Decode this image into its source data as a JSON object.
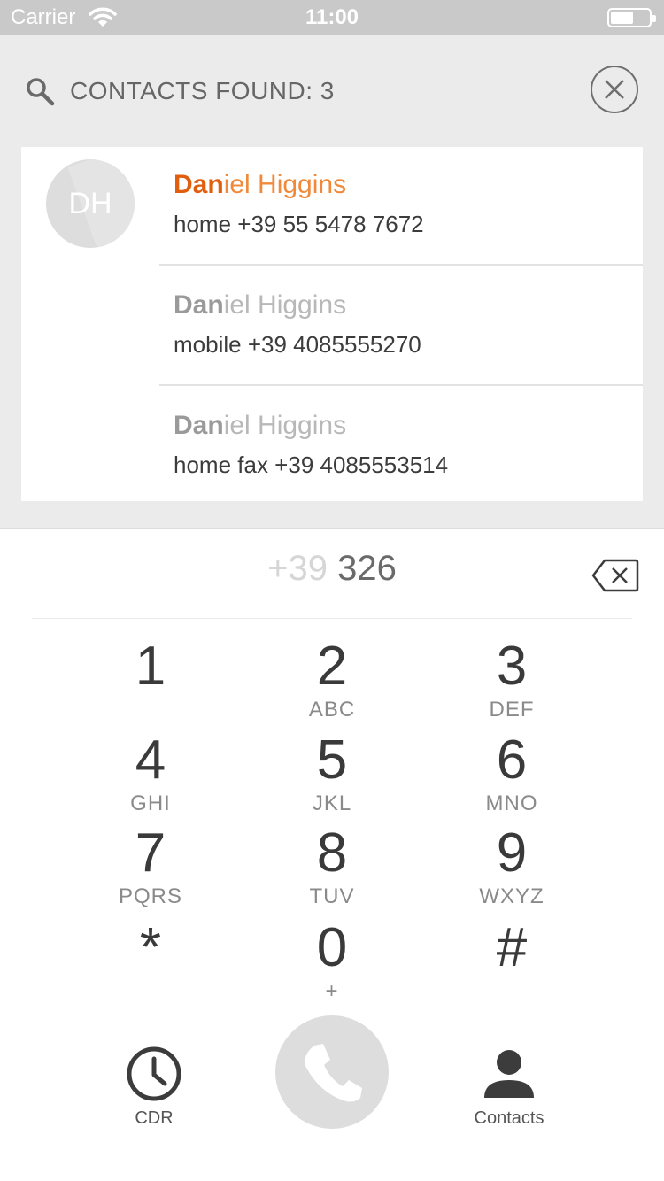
{
  "status_bar": {
    "carrier": "Carrier",
    "time": "11:00",
    "battery_level": 0.6
  },
  "search": {
    "found_label": "CONTACTS FOUND: 3",
    "icon": "search-icon",
    "close_icon": "close-circle-icon"
  },
  "contact": {
    "initials": "DH",
    "entries": [
      {
        "name_match": "Dan",
        "name_rest": "iel Higgins",
        "number": "home +39 55 5478 7672",
        "selected": true
      },
      {
        "name_match": "Dan",
        "name_rest": "iel Higgins",
        "number": "mobile +39 4085555270",
        "selected": false
      },
      {
        "name_match": "Dan",
        "name_rest": "iel Higgins",
        "number": "home fax +39 4085553514",
        "selected": false
      }
    ]
  },
  "dialer": {
    "prefix": "+39",
    "number": "326",
    "keys": [
      {
        "digit": "1",
        "letters": ""
      },
      {
        "digit": "2",
        "letters": "ABC"
      },
      {
        "digit": "3",
        "letters": "DEF"
      },
      {
        "digit": "4",
        "letters": "GHI"
      },
      {
        "digit": "5",
        "letters": "JKL"
      },
      {
        "digit": "6",
        "letters": "MNO"
      },
      {
        "digit": "7",
        "letters": "PQRS"
      },
      {
        "digit": "8",
        "letters": "TUV"
      },
      {
        "digit": "9",
        "letters": "WXYZ"
      },
      {
        "digit": "*",
        "letters": ""
      },
      {
        "digit": "0",
        "letters": "+"
      },
      {
        "digit": "#",
        "letters": ""
      }
    ]
  },
  "bottom_bar": {
    "cdr_label": "CDR",
    "contacts_label": "Contacts",
    "icons": [
      "clock-icon",
      "phone-icon",
      "person-icon"
    ]
  },
  "colors": {
    "accent": "#e05e0e",
    "accent_light": "#f08a3a",
    "panel_bg": "#ebebeb",
    "call_button": "#dddddd"
  }
}
